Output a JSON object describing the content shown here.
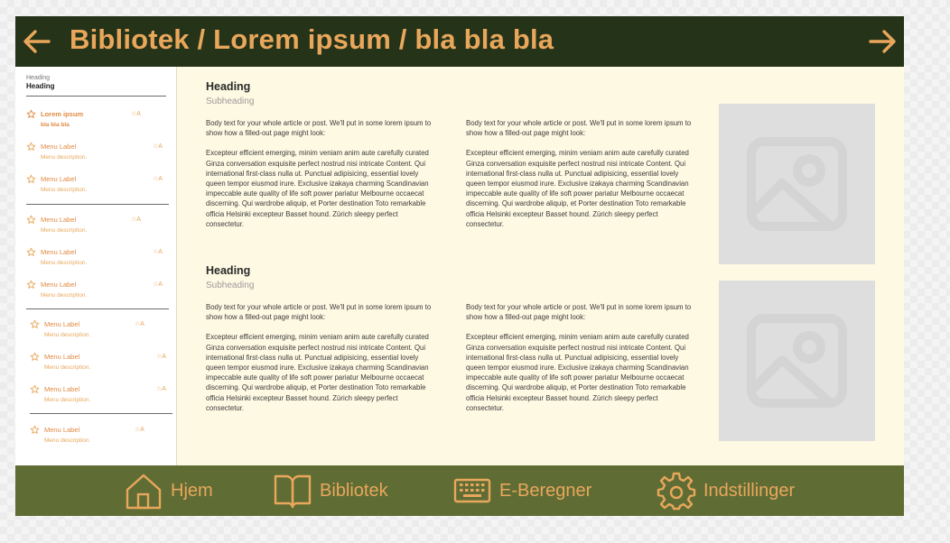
{
  "header": {
    "title": "Bibliotek / Lorem ipsum / bla bla bla",
    "back_icon": "arrow-left-icon",
    "forward_icon": "arrow-right-icon",
    "bg_color": "#253319",
    "accent_color": "#e9a75b"
  },
  "sidebar": {
    "caption": "Heading",
    "heading": "Heading",
    "items": [
      {
        "label": "Lorem ipsum",
        "description": "bla bla bla",
        "mark": "☆A",
        "active": true
      },
      {
        "label": "Menu Label",
        "description": "Menu description.",
        "mark": "☆A"
      },
      {
        "label": "Menu Label",
        "description": "Menu description.",
        "mark": "☆A"
      },
      {
        "label": "Menu Label",
        "description": "Menu description.",
        "mark": "☆A"
      },
      {
        "label": "Menu Label",
        "description": "Menu description.",
        "mark": "☆A"
      },
      {
        "label": "Menu Label",
        "description": "Menu description.",
        "mark": "☆A"
      },
      {
        "label": "Menu Label",
        "description": "Menu description.",
        "mark": "☆A"
      },
      {
        "label": "Menu Label",
        "description": "Menu description.",
        "mark": "☆A"
      },
      {
        "label": "Menu Label",
        "description": "Menu description.",
        "mark": "☆A"
      },
      {
        "label": "Menu Label",
        "description": "Menu description.",
        "mark": "☆A"
      }
    ]
  },
  "sections": [
    {
      "heading": "Heading",
      "subheading": "Subheading",
      "col1_p1": "Body text for your whole article or post. We'll put in some lorem ipsum to show how a filled-out page might look:",
      "col1_p2": "Excepteur efficient emerging, minim veniam anim aute carefully curated Ginza conversation exquisite perfect nostrud nisi intricate Content. Qui  international first-class nulla ut. Punctual adipisicing, essential lovely queen tempor eiusmod irure. Exclusive izakaya charming Scandinavian impeccable aute quality of life soft power pariatur Melbourne occaecat discerning. Qui wardrobe aliquip, et Porter destination Toto remarkable officia Helsinki excepteur Basset hound. Zürich sleepy perfect consectetur.",
      "col2_p1": "Body text for your whole article or post. We'll put in some lorem ipsum to show how a filled-out page might look:",
      "col2_p2": "Excepteur efficient emerging, minim veniam anim aute carefully curated Ginza conversation exquisite perfect nostrud nisi intricate Content. Qui  international first-class nulla ut. Punctual adipisicing, essential lovely queen tempor eiusmod irure. Exclusive izakaya charming Scandinavian impeccable aute quality of life soft power pariatur Melbourne occaecat discerning. Qui wardrobe aliquip, et Porter destination Toto remarkable officia Helsinki excepteur Basset hound. Zürich sleepy perfect consectetur.",
      "image_icon": "image-placeholder-icon"
    },
    {
      "heading": "Heading",
      "subheading": "Subheading",
      "col1_p1": "Body text for your whole article or post. We'll put in some lorem ipsum to show how a filled-out page might look:",
      "col1_p2": "Excepteur efficient emerging, minim veniam anim aute carefully curated Ginza conversation exquisite perfect nostrud nisi intricate Content. Qui  international first-class nulla ut. Punctual adipisicing, essential lovely queen tempor eiusmod irure. Exclusive izakaya charming Scandinavian impeccable aute quality of life soft power pariatur Melbourne occaecat discerning. Qui wardrobe aliquip, et Porter destination Toto remarkable officia Helsinki excepteur Basset hound. Zürich sleepy perfect consectetur.",
      "col2_p1": "Body text for your whole article or post. We'll put in some lorem ipsum to show how a filled-out page might look:",
      "col2_p2": "Excepteur efficient emerging, minim veniam anim aute carefully curated Ginza conversation exquisite perfect nostrud nisi intricate Content. Qui  international first-class nulla ut. Punctual adipisicing, essential lovely queen tempor eiusmod irure. Exclusive izakaya charming Scandinavian impeccable aute quality of life soft power pariatur Melbourne occaecat discerning. Qui wardrobe aliquip, et Porter destination Toto remarkable officia Helsinki excepteur Basset hound. Zürich sleepy perfect consectetur.",
      "image_icon": "image-placeholder-icon"
    }
  ],
  "bottom_nav": {
    "bg_color": "#5f6d35",
    "items": [
      {
        "label": "Hjem",
        "icon": "home-icon"
      },
      {
        "label": "Bibliotek",
        "icon": "book-icon"
      },
      {
        "label": "E-Beregner",
        "icon": "keyboard-icon"
      },
      {
        "label": "Indstillinger",
        "icon": "gear-icon"
      }
    ]
  }
}
